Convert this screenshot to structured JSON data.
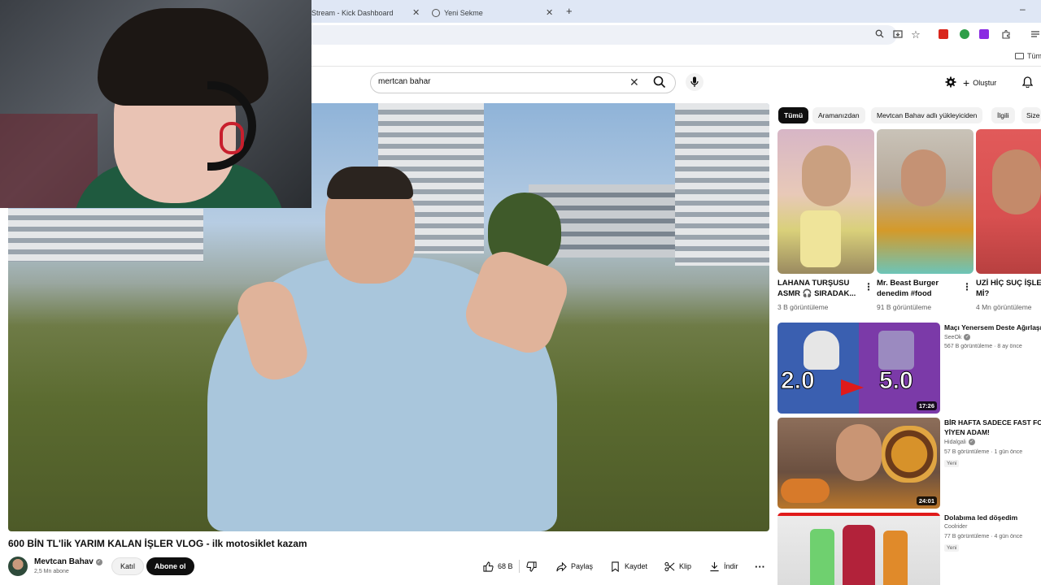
{
  "browser": {
    "tabs": [
      {
        "title": "Stream - Kick Dashboard"
      },
      {
        "title": "Yeni Sekme"
      }
    ],
    "new_tab": "+",
    "bookmark_all": "Tüm"
  },
  "header": {
    "search_value": "mertcan bahar",
    "create_label": "Oluştur"
  },
  "video": {
    "title": "600 BİN TL'lik YARIM KALAN İŞLER VLOG - ilk motosiklet kazam",
    "channel": "Mevtcan Bahav",
    "subscribers": "2,5 Mn abone",
    "join_label": "Katıl",
    "subscribe_label": "Abone ol",
    "likes": "68 B",
    "share_label": "Paylaş",
    "save_label": "Kaydet",
    "clip_label": "Klip",
    "download_label": "İndir"
  },
  "chips": [
    "Tümü",
    "Aramanızdan",
    "Mevtcan Bahav adlı yükleyiciden",
    "İlgili",
    "Size"
  ],
  "shorts": [
    {
      "title_line1": "LAHANA TURŞUSU",
      "title_line2": "ASMR 🎧 SIRADAK...",
      "views": "3 B görüntüleme"
    },
    {
      "title_line1": "Mr. Beast Burger",
      "title_line2": "denedim #food",
      "views": "91 B görüntüleme"
    },
    {
      "title_line1": "UZİ HİÇ SUÇ İŞLEI",
      "title_line2": "Mİ?",
      "views": "4 Mn görüntüleme"
    }
  ],
  "related": [
    {
      "title_line1": "Maçı Yenersem Deste Ağırlaşır",
      "title_line2": "",
      "channel": "SeeOk",
      "meta": "567 B görüntüleme · 8 ay önce",
      "duration": "17:26",
      "thumb_text_left": "2.0",
      "thumb_text_right": "5.0",
      "badge": ""
    },
    {
      "title_line1": "BİR HAFTA SADECE FAST FOO",
      "title_line2": "YİYEN ADAM!",
      "channel": "Hidalgali",
      "meta": "57 B görüntüleme · 1 gün önce",
      "duration": "24:01",
      "badge": "Yeni"
    },
    {
      "title_line1": "Dolabıma led döşedim",
      "title_line2": "",
      "channel": "Coolrider",
      "meta": "77 B görüntüleme · 4 gün önce",
      "duration": "",
      "badge": "Yeni"
    }
  ]
}
